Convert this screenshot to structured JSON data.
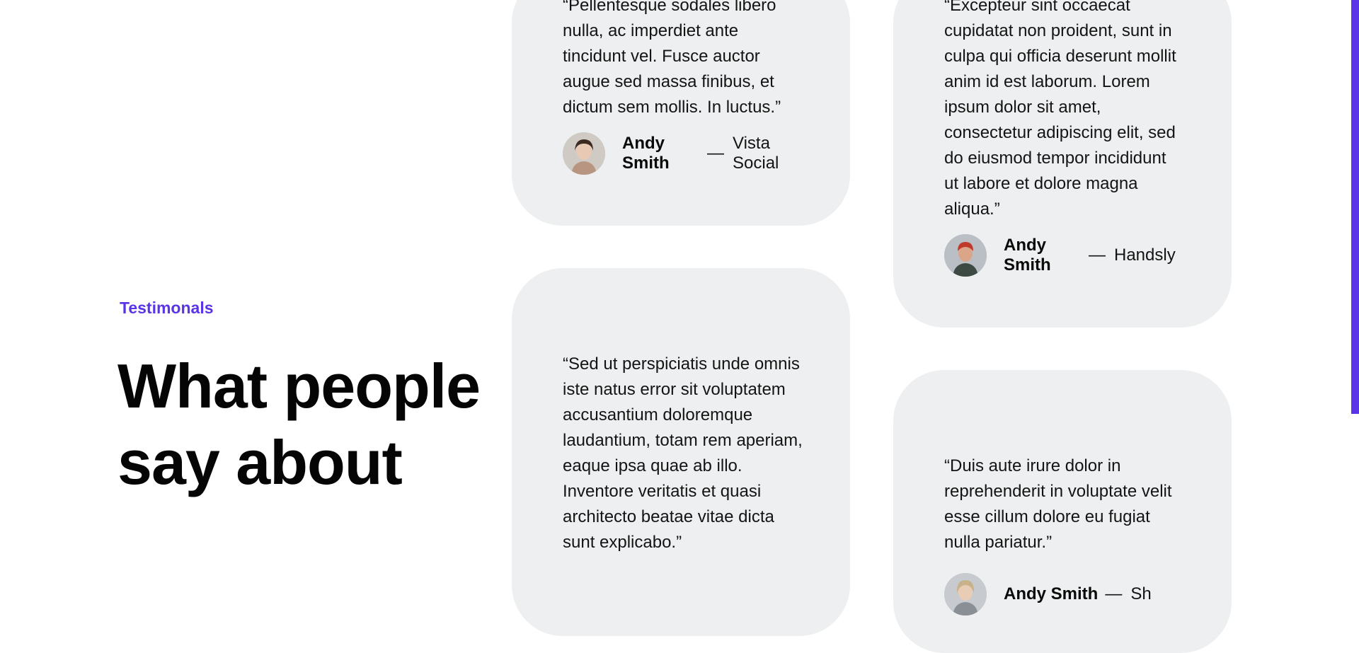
{
  "section": {
    "eyebrow": "Testimonals",
    "headline": "What people say about"
  },
  "testimonials": [
    {
      "quote": "“Pellentesque sodales libero nulla, ac imperdiet ante tincidunt vel. Fusce auctor augue sed massa finibus, et dictum sem mollis. In luctus.”",
      "name": "Andy Smith",
      "dash": "—",
      "company": "Vista Social"
    },
    {
      "quote": "“Excepteur sint occaecat cupidatat non proident, sunt in culpa qui officia deserunt mollit anim id est laborum. Lorem ipsum dolor sit amet, consectetur adipiscing elit, sed do eiusmod tempor incididunt ut labore et dolore magna aliqua.”",
      "name": "Andy Smith",
      "dash": "—",
      "company": "Handsly"
    },
    {
      "quote": "“Sed ut perspiciatis unde omnis iste natus error sit voluptatem accusantium doloremque laudantium, totam rem aperiam, eaque ipsa quae ab illo. Inventore veritatis et quasi architecto beatae vitae dicta sunt explicabo.”"
    },
    {
      "quote": "“Duis aute irure dolor in reprehenderit in voluptate velit esse cillum dolore eu fugiat nulla pariatur.”",
      "name": "Andy Smith",
      "dash": "—",
      "company": "Sh"
    }
  ],
  "colors": {
    "accent": "#5b34e8",
    "card_background": "#eeeff0",
    "text": "#141414"
  }
}
